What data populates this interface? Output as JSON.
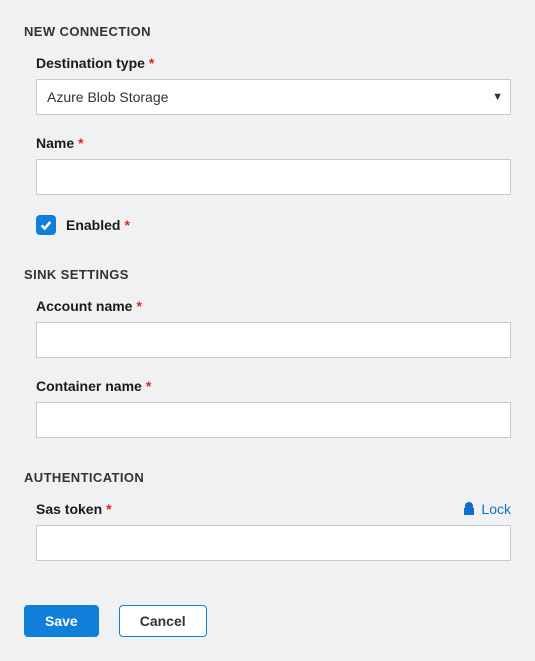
{
  "sections": {
    "new_connection": {
      "heading": "NEW CONNECTION",
      "destination_type": {
        "label": "Destination type",
        "value": "Azure Blob Storage"
      },
      "name": {
        "label": "Name",
        "value": ""
      },
      "enabled": {
        "label": "Enabled",
        "checked": true
      }
    },
    "sink_settings": {
      "heading": "SINK SETTINGS",
      "account_name": {
        "label": "Account name",
        "value": ""
      },
      "container_name": {
        "label": "Container name",
        "value": ""
      }
    },
    "authentication": {
      "heading": "AUTHENTICATION",
      "sas_token": {
        "label": "Sas token",
        "value": "",
        "lock_label": "Lock"
      }
    }
  },
  "buttons": {
    "save": "Save",
    "cancel": "Cancel"
  },
  "required_marker": "*",
  "colors": {
    "primary": "#0f7fd9",
    "required": "#e02424",
    "background": "#f0f1f2",
    "border": "#c8ccd0"
  }
}
